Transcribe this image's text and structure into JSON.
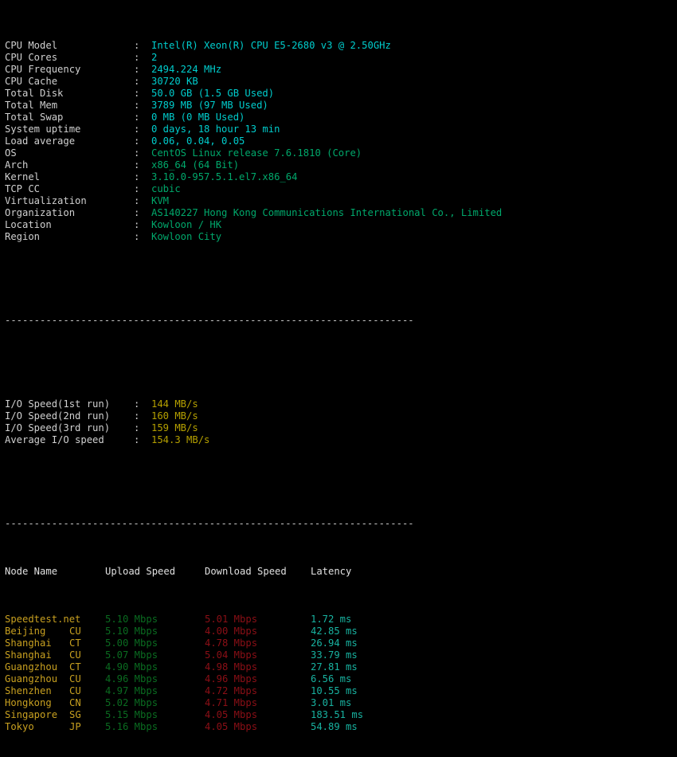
{
  "system_info": {
    "rows": [
      {
        "label": "CPU Model",
        "value": "Intel(R) Xeon(R) CPU E5-2680 v3 @ 2.50GHz",
        "color": "cyan"
      },
      {
        "label": "CPU Cores",
        "value": "2",
        "color": "cyan"
      },
      {
        "label": "CPU Frequency",
        "value": "2494.224 MHz",
        "color": "cyan"
      },
      {
        "label": "CPU Cache",
        "value": "30720 KB",
        "color": "cyan"
      },
      {
        "label": "Total Disk",
        "value": "50.0 GB (1.5 GB Used)",
        "color": "cyan"
      },
      {
        "label": "Total Mem",
        "value": "3789 MB (97 MB Used)",
        "color": "cyan"
      },
      {
        "label": "Total Swap",
        "value": "0 MB (0 MB Used)",
        "color": "cyan"
      },
      {
        "label": "System uptime",
        "value": "0 days, 18 hour 13 min",
        "color": "cyan"
      },
      {
        "label": "Load average",
        "value": "0.06, 0.04, 0.05",
        "color": "cyan"
      },
      {
        "label": "OS",
        "value": "CentOS Linux release 7.6.1810 (Core)",
        "color": "green"
      },
      {
        "label": "Arch",
        "value": "x86_64 (64 Bit)",
        "color": "green"
      },
      {
        "label": "Kernel",
        "value": "3.10.0-957.5.1.el7.x86_64",
        "color": "green"
      },
      {
        "label": "TCP CC",
        "value": "cubic",
        "color": "green"
      },
      {
        "label": "Virtualization",
        "value": "KVM",
        "color": "green"
      },
      {
        "label": "Organization",
        "value": "AS140227 Hong Kong Communications International Co., Limited",
        "color": "green"
      },
      {
        "label": "Location",
        "value": "Kowloon / HK",
        "color": "green"
      },
      {
        "label": "Region",
        "value": "Kowloon City",
        "color": "green"
      }
    ]
  },
  "separator": "----------------------------------------------------------------------",
  "io_speed": {
    "rows": [
      {
        "label": "I/O Speed(1st run)",
        "value": "144 MB/s"
      },
      {
        "label": "I/O Speed(2nd run)",
        "value": "160 MB/s"
      },
      {
        "label": "I/O Speed(3rd run)",
        "value": "159 MB/s"
      },
      {
        "label": "Average I/O speed",
        "value": "154.3 MB/s"
      }
    ]
  },
  "speedtest": {
    "headers": {
      "node": "Node Name",
      "upload": "Upload Speed",
      "download": "Download Speed",
      "latency": "Latency"
    },
    "rows": [
      {
        "node": "Speedtest.net",
        "isp": "",
        "upload": "5.10 Mbps",
        "download": "5.01 Mbps",
        "latency": "1.72 ms"
      },
      {
        "node": "Beijing",
        "isp": "CU",
        "upload": "5.10 Mbps",
        "download": "4.00 Mbps",
        "latency": "42.85 ms"
      },
      {
        "node": "Shanghai",
        "isp": "CT",
        "upload": "5.00 Mbps",
        "download": "4.78 Mbps",
        "latency": "26.94 ms"
      },
      {
        "node": "Shanghai",
        "isp": "CU",
        "upload": "5.07 Mbps",
        "download": "5.04 Mbps",
        "latency": "33.79 ms"
      },
      {
        "node": "Guangzhou",
        "isp": "CT",
        "upload": "4.90 Mbps",
        "download": "4.98 Mbps",
        "latency": "27.81 ms"
      },
      {
        "node": "Guangzhou",
        "isp": "CU",
        "upload": "4.96 Mbps",
        "download": "4.96 Mbps",
        "latency": "6.56 ms"
      },
      {
        "node": "Shenzhen",
        "isp": "CU",
        "upload": "4.97 Mbps",
        "download": "4.72 Mbps",
        "latency": "10.55 ms"
      },
      {
        "node": "Hongkong",
        "isp": "CN",
        "upload": "5.02 Mbps",
        "download": "4.71 Mbps",
        "latency": "3.01 ms"
      },
      {
        "node": "Singapore",
        "isp": "SG",
        "upload": "5.15 Mbps",
        "download": "4.05 Mbps",
        "latency": "183.51 ms"
      },
      {
        "node": "Tokyo",
        "isp": "JP",
        "upload": "5.16 Mbps",
        "download": "4.05 Mbps",
        "latency": "54.89 ms"
      }
    ]
  },
  "colors": {
    "background": "#000000",
    "label": "#d0d0d0",
    "cyan": "#00cdcd",
    "green": "#00a86b",
    "yellow": "#b5a000",
    "node": "#c8a020",
    "upload": "#0a6b20",
    "download": "#8b0f16",
    "latency": "#18b2a0"
  }
}
